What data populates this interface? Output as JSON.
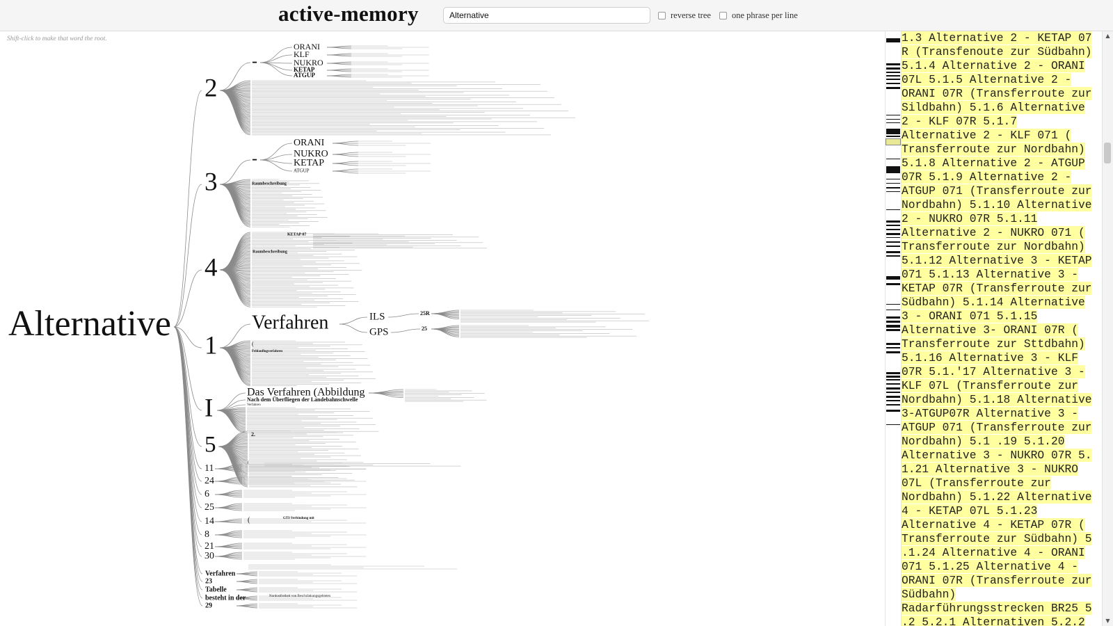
{
  "header": {
    "title": "active-memory",
    "search_value": "Alternative",
    "reverse_tree_label": "reverse tree",
    "one_phrase_label": "one phrase per line"
  },
  "hint": "Shift-click to make that word the root.",
  "tree": {
    "root": "Alternative",
    "branches": [
      "2",
      "3",
      "4",
      "1",
      "I",
      "5",
      "11",
      "24",
      "6",
      "25",
      "14",
      "8",
      "21",
      "30",
      "Verfahren",
      "23",
      "Tabelle",
      "besteht in der",
      "29"
    ],
    "subnodes": {
      "dash": "-",
      "two_children": [
        "ORANI",
        "KLF",
        "NUKRO",
        "KETAP",
        "ATGUP"
      ],
      "three_children": [
        "ORANI",
        "NUKRO",
        "KETAP",
        "ATGUP"
      ],
      "one_children": [
        "Verfahren",
        "ILS",
        "GPS",
        "25R",
        "25",
        "(",
        "Fehlanflugverfahren"
      ],
      "i_children": [
        "Das Verfahren (Abbildung",
        "Nach dem Überfliegen der Landebahnschwelle",
        "Verfahren"
      ],
      "five_children": [
        "2.",
        "(",
        "GTI-Verbindung mit",
        "Nordostfreiheit von Beschränkungsgebieten"
      ],
      "four_children": [
        "KETAP 07",
        "Raumbeschreibung"
      ],
      "three_extra": [
        "Raumbeschreibung"
      ]
    }
  },
  "text_lines": [
    "1.3 Alternative 2 - KETAP 07",
    "R (Transfenoute zur Südbahn)",
    "5.1.4 Alternative 2 - ORANI",
    "07L 5.1.5 Alternative 2 -",
    "ORANI 07R (Transferroute zur",
    "Sildbahn) 5.1.6 Alternative",
    "2 - KLF 07R 5.1.7",
    "Alternative 2 - KLF 071 (",
    "Transferroute zur Nordbahn)",
    "5.1.8 Alternative 2 - ATGUP",
    "07R 5.1.9 Alternative 2 -",
    "ATGUP 071 (Transferroute zur",
    "Nordbahn) 5.1.10 Alternative",
    "2 - NUKRO 07R 5.1.11",
    "Alternative 2 - NUKRO 071 (",
    "Transferroute zur Nordbahn)",
    "5.1.12 Alternative 3 - KETAP",
    "071 5.1.13 Alternative 3 -",
    "KETAP 07R (Transferroute zur",
    "Südbahn) 5.1.14 Alternative",
    "3 - ORANI 071 5.1.15",
    "Alternative 3- ORANI 07R (",
    "Transferroute zur Sttdbahn)",
    "5.1.16 Alternative 3 - KLF",
    "07R 5.1.'17 Alternative 3 -",
    "KLF 07L (Transferroute zur",
    "Nordbahn) 5.1.18 Alternative",
    "3-ATGUP07R Alternative 3 -",
    "ATGUP 071 (Transferroute zur",
    "Nordbahn) 5.1 .19 5.1.20",
    "Alternative 3 - NUKRO 07R 5.",
    "1.21 Alternative 3 - NUKRO",
    "07L (Transferroute zur",
    "Nordbahn) 5.1.22 Alternative",
    "4 - KETAP 07L 5.1.23",
    "Alternative 4 - KETAP 07R (",
    "Transferroute zur Südbahn) 5",
    ".1.24 Alternative 4 - ORANI",
    "071 5.1.25 Alternative 4 -",
    "ORANI 07R (Transferroute zur",
    "Südbahn)",
    "Radarführungsstrecken BR25 5",
    ".2 5.2.1 Alternativen 5.2.2"
  ],
  "colors": {
    "highlight": "#ffffa0",
    "tree_line": "#888888",
    "text": "#222222"
  },
  "icons": {
    "scroll_up": "triangle-up-icon",
    "scroll_down": "triangle-down-icon"
  }
}
